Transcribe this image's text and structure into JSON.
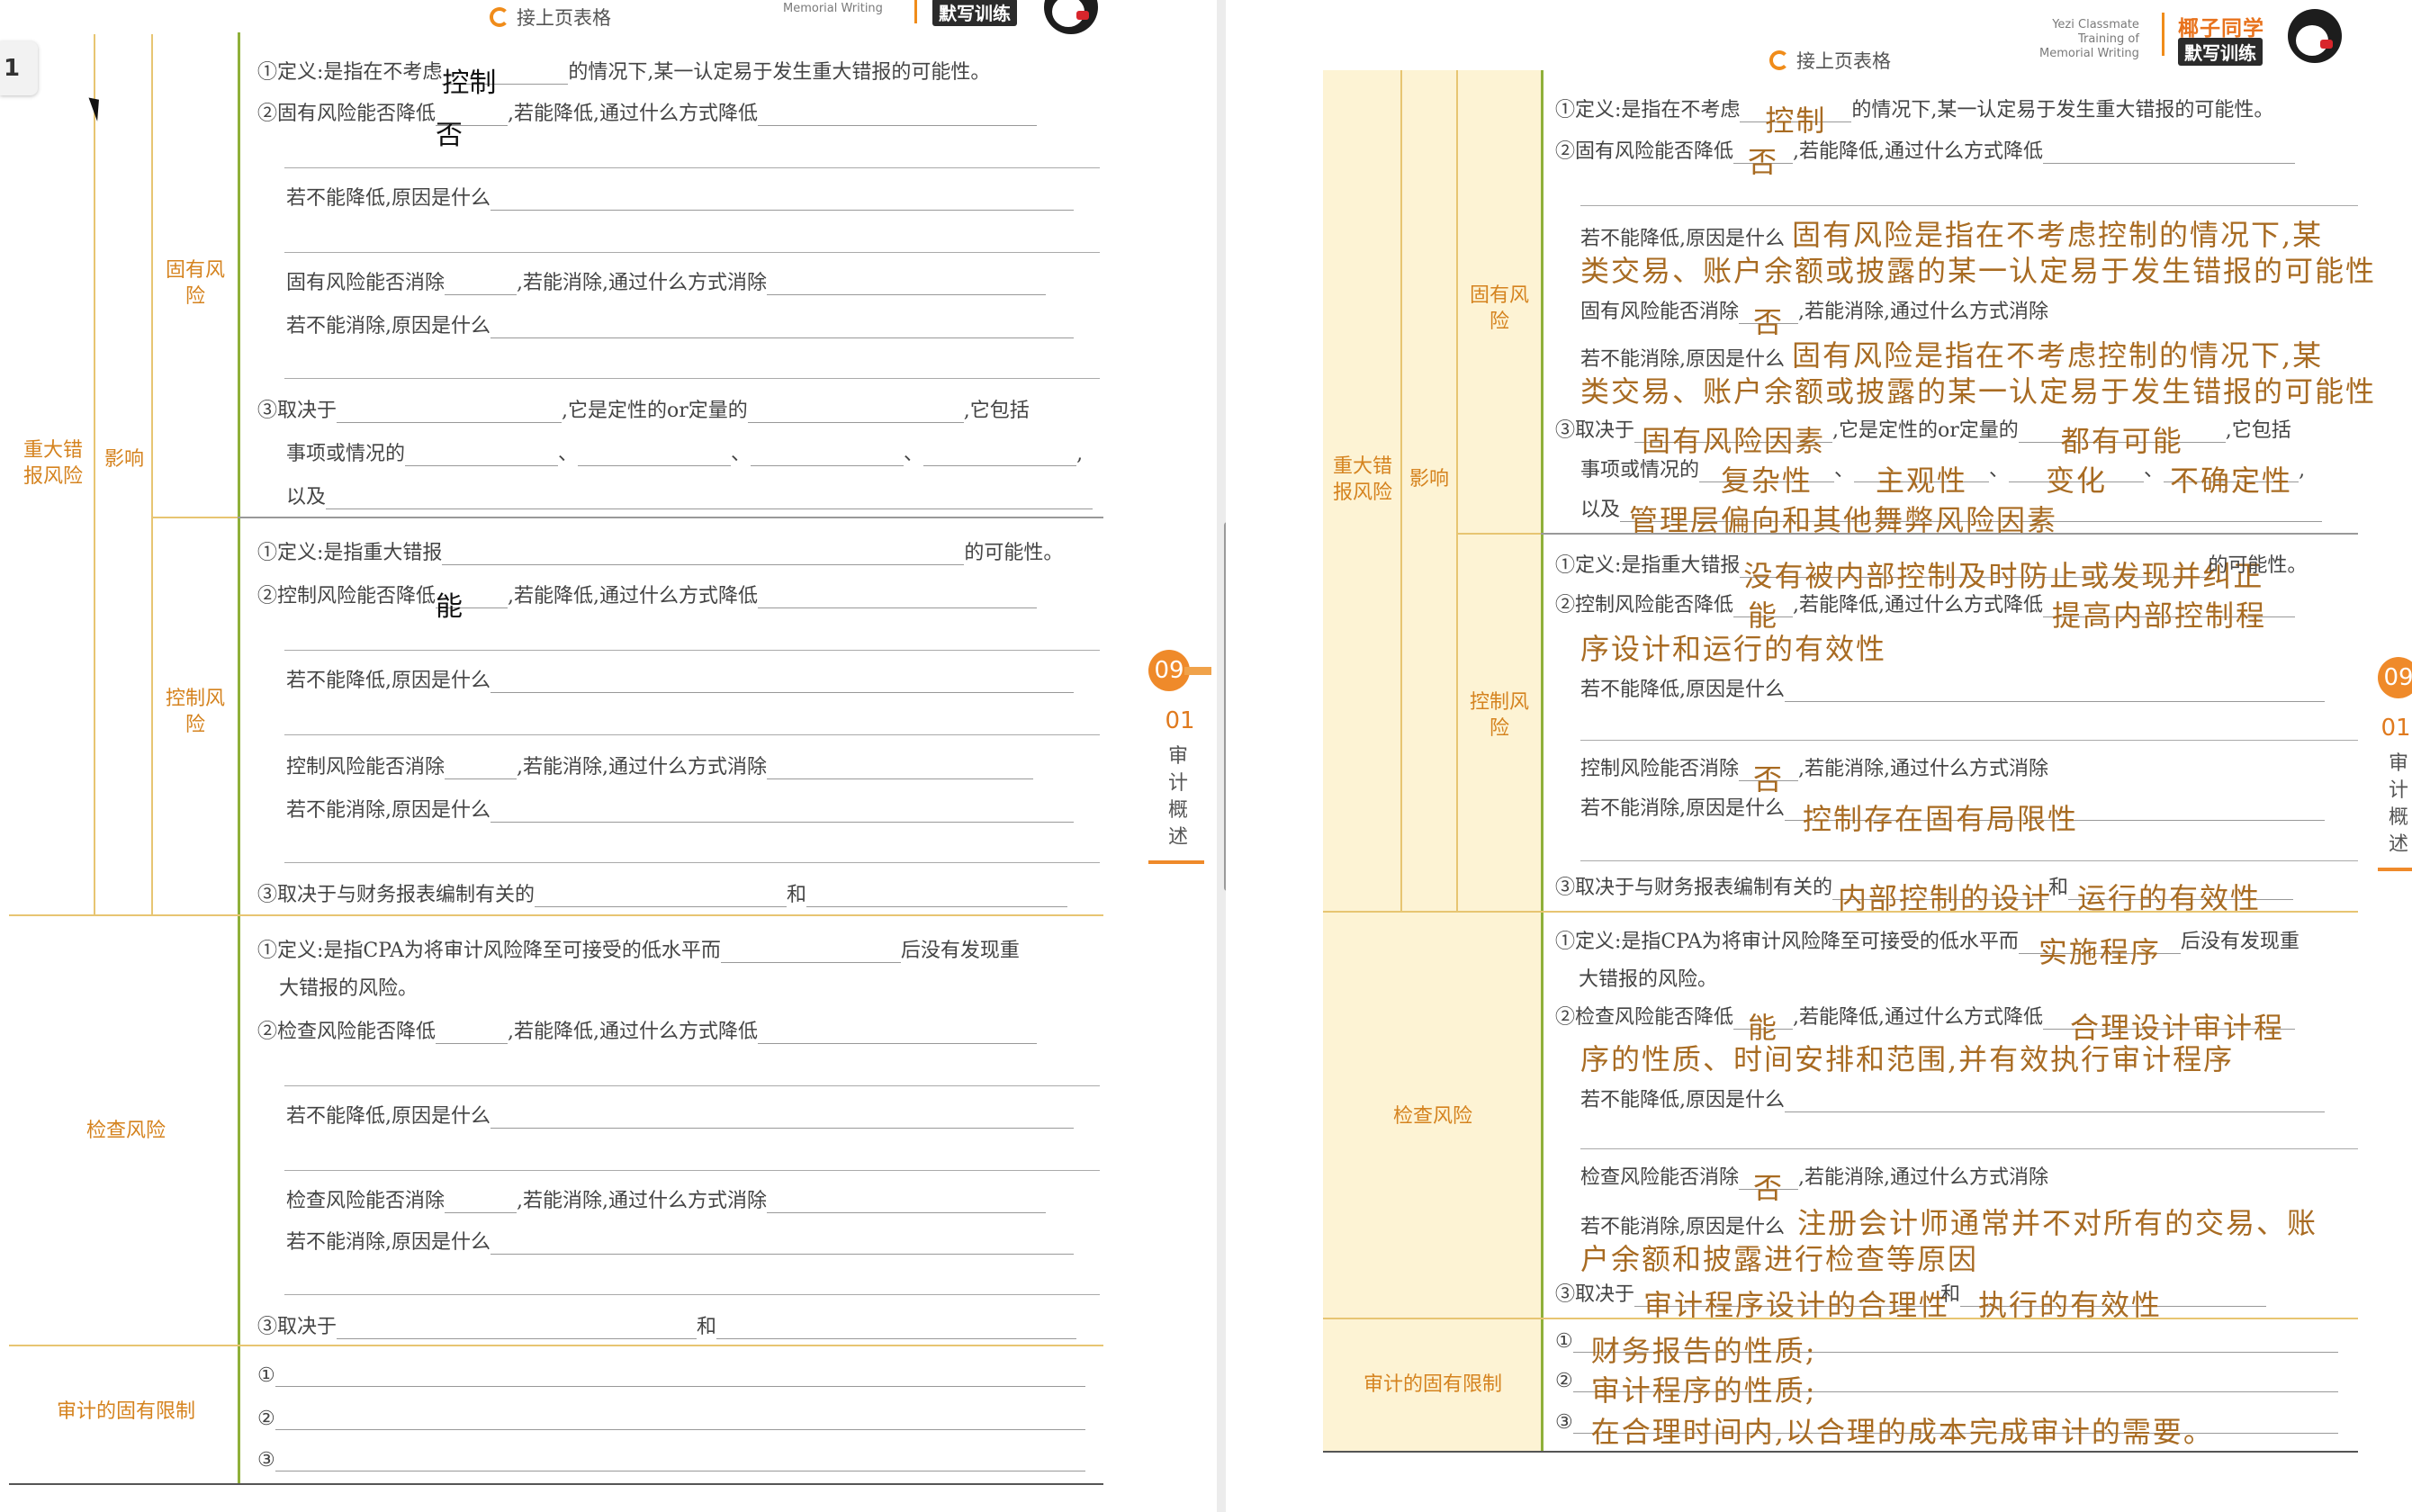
{
  "viewer": {
    "zoom_label": "1",
    "page_number": "09",
    "chapter_number": "01",
    "chapter_title": "审计概述"
  },
  "header": {
    "next_page": "接上页表格",
    "brand_en": [
      "Yezi Classmate",
      "Training of",
      "Memorial Writing"
    ],
    "brand_en_left": "Memorial Writing",
    "brand_cn": "椰子同学",
    "brand_tag": "默写训练"
  },
  "categories": {
    "major": "重大错报风险",
    "influence": "影响",
    "inherent": "固有风险",
    "control": "控制风险",
    "detection": "检查风险",
    "limits": "审计的固有限制"
  },
  "prompts": {
    "ir_def_a": "①定义:是指在不考虑",
    "ir_def_b": "的情况下,某一认定易于发生重大错报的可能性。",
    "ir_reduce_a": "②固有风险能否降低",
    "ir_reduce_b": ",若能降低,通过什么方式降低",
    "why_not_reduce": "若不能降低,原因是什么",
    "ir_elim_a": "固有风险能否消除",
    "ir_elim_b": ",若能消除,通过什么方式消除",
    "why_not_elim": "若不能消除,原因是什么",
    "ir_dep_a": "③取决于",
    "ir_dep_b": ",它是定性的or定量的",
    "ir_dep_c": ",它包括",
    "ir_events": "事项或情况的",
    "and_also": "以及",
    "cr_def_a": "①定义:是指重大错报",
    "cr_def_b": "的可能性。",
    "cr_reduce_a": "②控制风险能否降低",
    "cr_reduce_b": ",若能降低,通过什么方式降低",
    "cr_elim_a": "控制风险能否消除",
    "cr_elim_b": ",若能消除,通过什么方式消除",
    "cr_dep": "③取决于与财务报表编制有关的",
    "and": "和",
    "dr_def_a": "①定义:是指CPA为将审计风险降至可接受的低水平而",
    "dr_def_b": "后没有发现重",
    "dr_def_c": "大错报的风险。",
    "dr_reduce_a": "②检查风险能否降低",
    "dr_reduce_b": ",若能降低,通过什么方式降低",
    "dr_elim_a": "检查风险能否消除",
    "dr_elim_b": ",若能消除,通过什么方式消除",
    "dr_dep": "③取决于",
    "n1": "①",
    "n2": "②",
    "n3": "③"
  },
  "left_answers": {
    "ir_def": "控制",
    "ir_reduce": "否",
    "cr_reduce": "能"
  },
  "right_answers": {
    "ir_def": "控制",
    "ir_reduce": "否",
    "ir_why_1": "固有风险是指在不考虑控制的情况下,某",
    "ir_why_2": "类交易、账户余额或披露的某一认定易于发生错报的可能性",
    "ir_elim": "否",
    "ir_why_elim_1": "固有风险是指在不考虑控制的情况下,某",
    "ir_why_elim_2": "类交易、账户余额或披露的某一认定易于发生错报的可能性",
    "ir_dep": "固有风险因素",
    "ir_qual": "都有可能",
    "ir_ev1": "复杂性",
    "ir_ev2": "主观性",
    "ir_ev3": "变化",
    "ir_ev4": "不确定性",
    "ir_also": "管理层偏向和其他舞弊风险因素",
    "cr_def": "没有被内部控制及时防止或发现并纠正",
    "cr_reduce": "能",
    "cr_how_1": "提高内部控制程",
    "cr_how_2": "序设计和运行的有效性",
    "cr_elim": "否",
    "cr_why_elim": "控制存在固有局限性",
    "cr_dep1": "内部控制的设计",
    "cr_dep2": "运行的有效性",
    "dr_def": "实施程序",
    "dr_reduce": "能",
    "dr_how_1": "合理设计审计程",
    "dr_how_2": "序的性质、时间安排和范围,并有效执行审计程序",
    "dr_elim": "否",
    "dr_why_elim_1": "注册会计师通常并不对所有的交易、账",
    "dr_why_elim_2": "户余额和披露进行检查等原因",
    "dr_dep1": "审计程序设计的合理性",
    "dr_dep2": "执行的有效性",
    "lim1": "财务报告的性质;",
    "lim2": "审计程序的性质;",
    "lim3": "在合理时间内,以合理的成本完成审计的需要。"
  },
  "colors": {
    "accent": "#ef8a2a",
    "category_text": "#d5831f",
    "rule": "#e7c572",
    "handwriting": "#a86b22",
    "highlight_bg": "#fdf3d4"
  }
}
